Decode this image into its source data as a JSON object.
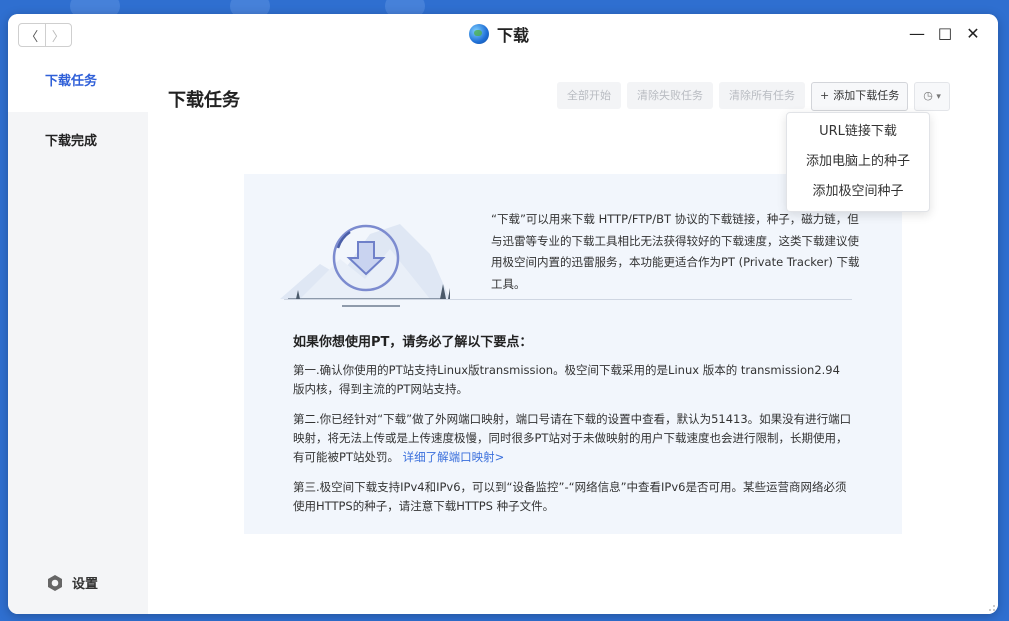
{
  "app": {
    "title": "下载"
  },
  "window_controls": {
    "minimize": "—",
    "maximize": "□",
    "close": "✕"
  },
  "nav": {
    "back": "〈",
    "forward": "〉"
  },
  "sidebar": {
    "items": [
      {
        "label": "下载任务",
        "active": true
      },
      {
        "label": "下载完成",
        "active": false
      }
    ],
    "settings_label": "设置"
  },
  "main": {
    "title": "下载任务",
    "toolbar": {
      "start_all": "全部开始",
      "clear_failed": "清除失败任务",
      "clear_all": "清除所有任务",
      "add_task_plus": "+",
      "add_task": "添加下载任务",
      "schedule_icon": "◷",
      "schedule_caret": "▾"
    },
    "add_menu": [
      "URL链接下载",
      "添加电脑上的种子",
      "添加极空间种子"
    ]
  },
  "info": {
    "intro": "“下载”可以用来下载 HTTP/FTP/BT 协议的下载链接，种子，磁力链，但与迅雷等专业的下载工具相比无法获得较好的下载速度，这类下载建议使用极空间内置的迅雷服务，本功能更适合作为PT (Private Tracker) 下载工具。",
    "heading": "如果你想使用PT，请务必了解以下要点：",
    "point1": "第一.确认你使用的PT站支持Linux版transmission。极空间下载采用的是Linux 版本的 transmission2.94 版内核，得到主流的PT网站支持。",
    "point2": "第二.你已经针对“下载”做了外网端口映射，端口号请在下载的设置中查看，默认为51413。如果没有进行端口映射，将无法上传或是上传速度极慢，同时很多PT站对于未做映射的用户下载速度也会进行限制，长期使用，有可能被PT站处罚。",
    "point2_link": "详细了解端口映射>",
    "point3": "第三.极空间下载支持IPv4和IPv6，可以到“设备监控”-“网络信息”中查看IPv6是否可用。某些运营商网络必须使用HTTPS的种子，请注意下载HTTPS 种子文件。"
  },
  "colors": {
    "accent": "#3060d8",
    "link": "#3a6fdc",
    "card_bg": "#f2f6fc",
    "sidebar_bg": "#f4f5f7",
    "desktop_bg": "#2f6fd0"
  }
}
